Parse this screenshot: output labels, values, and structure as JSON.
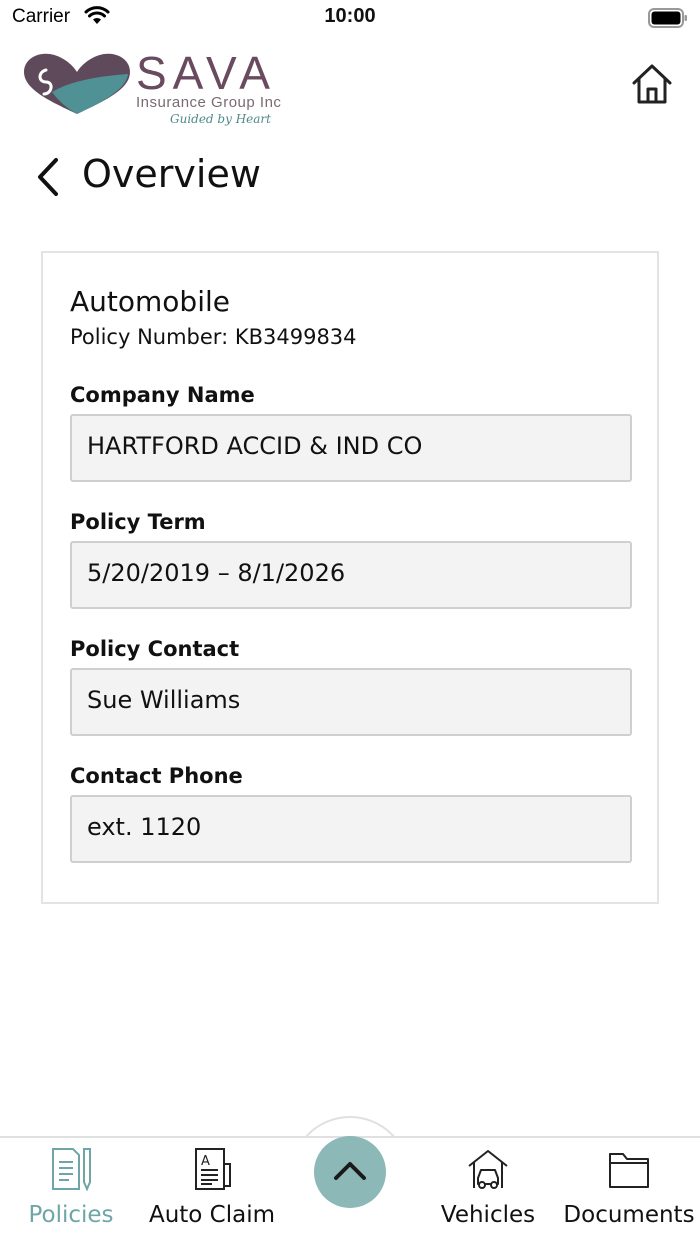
{
  "status_bar": {
    "carrier": "Carrier",
    "time": "10:00"
  },
  "header": {
    "logo_name": "SAVA",
    "logo_subtitle": "Insurance Group Inc",
    "logo_tagline": "Guided by Heart",
    "home_icon": "home-icon"
  },
  "page": {
    "title": "Overview",
    "back_icon": "chevron-left-icon"
  },
  "policy": {
    "type": "Automobile",
    "number_text": "Policy Number: KB3499834",
    "fields": [
      {
        "label": "Company Name",
        "value": "HARTFORD ACCID & IND CO"
      },
      {
        "label": "Policy Term",
        "value": "5/20/2019 – 8/1/2026"
      },
      {
        "label": "Policy Contact",
        "value": "Sue Williams"
      },
      {
        "label": "Contact Phone",
        "value": "ext. 1120"
      }
    ]
  },
  "tab_bar": {
    "tabs": [
      {
        "label": "Policies",
        "icon": "policy-document-icon",
        "active": true
      },
      {
        "label": "Auto Claim",
        "icon": "claim-form-icon",
        "active": false
      },
      {
        "label": "Vehicles",
        "icon": "car-garage-icon",
        "active": false
      },
      {
        "label": "Documents",
        "icon": "folder-icon",
        "active": false
      }
    ],
    "center_button_icon": "chevron-up-icon"
  },
  "colors": {
    "accent": "#6ea6a7",
    "center_button": "#8cb8b8",
    "logo_purple": "#6a4a5f",
    "field_bg": "#f3f3f4"
  }
}
